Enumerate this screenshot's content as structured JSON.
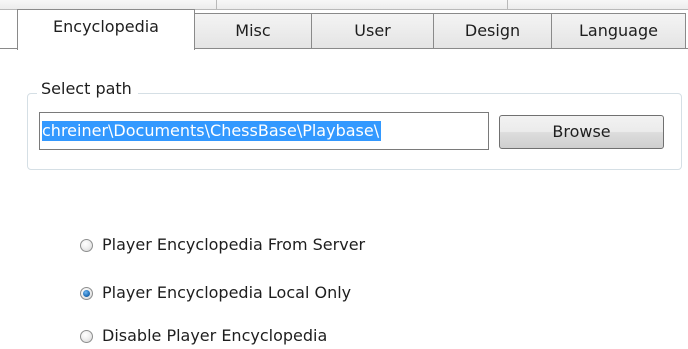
{
  "tabs": [
    {
      "label": "Encyclopedia",
      "selected": true
    },
    {
      "label": "Misc",
      "selected": false
    },
    {
      "label": "User",
      "selected": false
    },
    {
      "label": "Design",
      "selected": false
    },
    {
      "label": "Language",
      "selected": false
    }
  ],
  "path_group": {
    "legend": "Select path",
    "path_value": "chreiner\\Documents\\ChessBase\\Playbase\\",
    "browse_label": "Browse"
  },
  "encyclopedia_mode": {
    "options": [
      {
        "label": "Player Encyclopedia From Server",
        "checked": false
      },
      {
        "label": "Player Encyclopedia Local Only",
        "checked": true
      },
      {
        "label": "Disable Player Encyclopedia",
        "checked": false
      }
    ]
  },
  "colors": {
    "selection_highlight": "#3399ff",
    "radio_checked": "#1f6fb8",
    "group_border": "#d5dfe5"
  }
}
